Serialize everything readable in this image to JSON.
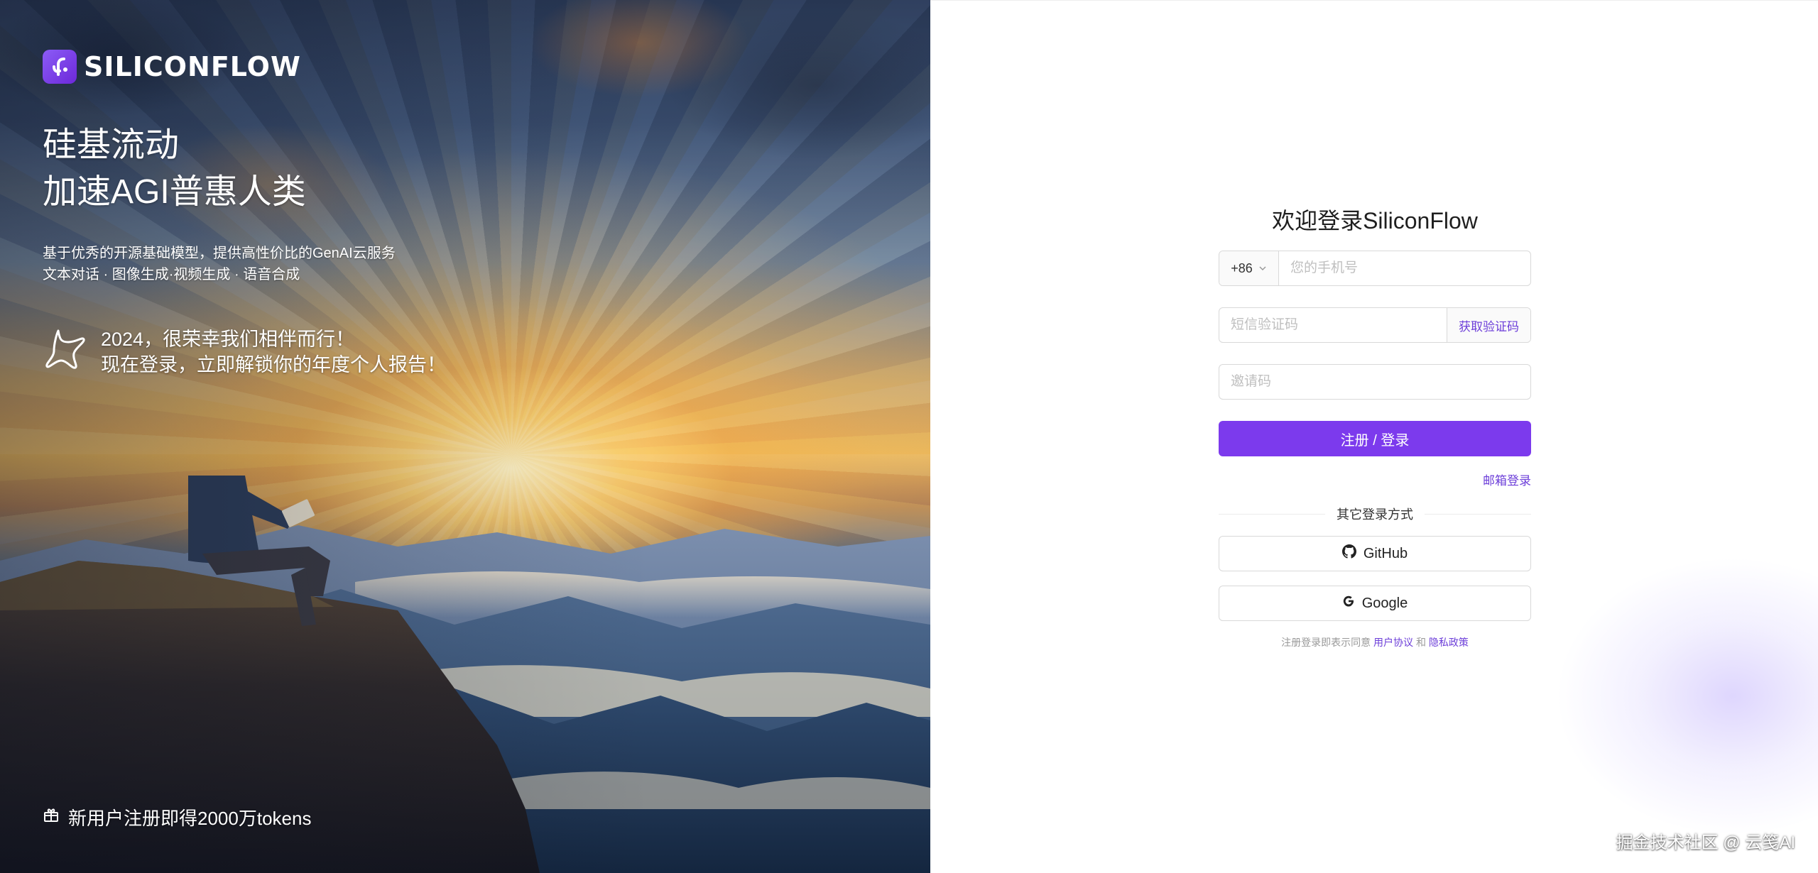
{
  "hero": {
    "brand_name": "SILICONFLOW",
    "title_line1": "硅基流动",
    "title_line2": "加速AGI普惠人类",
    "subtitle_line1": "基于优秀的开源基础模型，提供高性价比的GenAI云服务",
    "subtitle_line2": "文本对话 · 图像生成·视频生成 · 语音合成",
    "promo_line1": "2024，很荣幸我们相伴而行！",
    "promo_line2": "现在登录，立即解锁你的年度个人报告！",
    "footer_text": "新用户注册即得2000万tokens",
    "icons": {
      "brand": "siliconflow-logo-icon",
      "promo": "sparkle-star-icon",
      "footer": "gift-icon"
    }
  },
  "login": {
    "title": "欢迎登录SiliconFlow",
    "country_code": "+86",
    "phone_placeholder": "您的手机号",
    "sms_placeholder": "短信验证码",
    "get_code_label": "获取验证码",
    "invite_placeholder": "邀请码",
    "submit_label": "注册 / 登录",
    "email_login_label": "邮箱登录",
    "other_methods_label": "其它登录方式",
    "github_label": "GitHub",
    "google_label": "Google",
    "terms_prefix": "注册登录即表示同意",
    "terms_user_agreement": "用户协议",
    "terms_and": "和",
    "terms_privacy": "隐私政策"
  },
  "watermark": "掘金技术社区 @ 云笺AI",
  "colors": {
    "accent": "#7c3aed",
    "link": "#6d3fd9"
  }
}
